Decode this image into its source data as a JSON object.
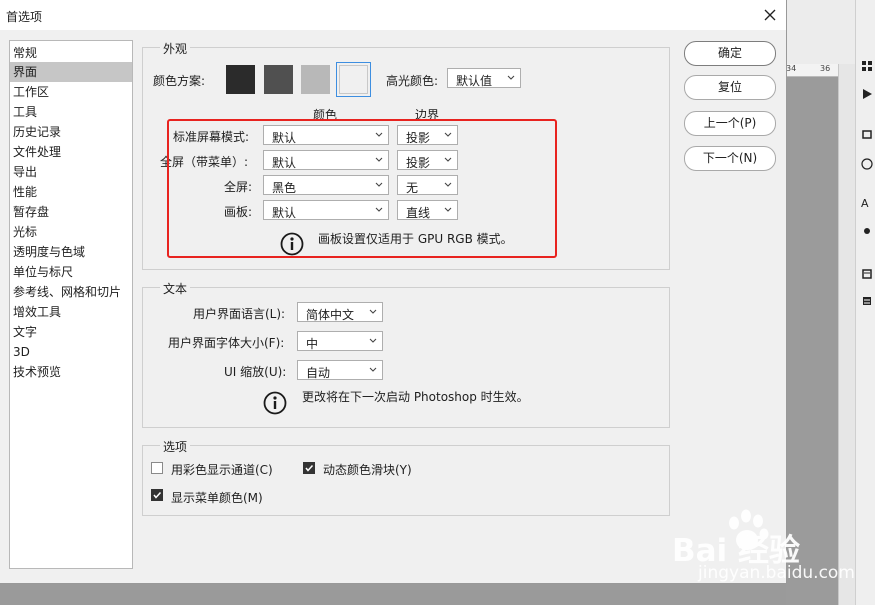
{
  "window": {
    "title": "首选项"
  },
  "sidebar": {
    "items": [
      {
        "label": "常规"
      },
      {
        "label": "界面"
      },
      {
        "label": "工作区"
      },
      {
        "label": "工具"
      },
      {
        "label": "历史记录"
      },
      {
        "label": "文件处理"
      },
      {
        "label": "导出"
      },
      {
        "label": "性能"
      },
      {
        "label": "暂存盘"
      },
      {
        "label": "光标"
      },
      {
        "label": "透明度与色域"
      },
      {
        "label": "单位与标尺"
      },
      {
        "label": "参考线、网格和切片"
      },
      {
        "label": "增效工具"
      },
      {
        "label": "文字"
      },
      {
        "label": "3D"
      },
      {
        "label": "技术预览"
      }
    ],
    "selected": "界面"
  },
  "appearance": {
    "group_label": "外观",
    "color_scheme_label": "颜色方案:",
    "swatch_colors": [
      "#2b2b2b",
      "#505050",
      "#b8b8b8",
      "#f0f0f0"
    ],
    "highlight_label": "高光颜色:",
    "highlight_value": "默认值",
    "col_color_header": "颜色",
    "col_border_header": "边界",
    "rows": [
      {
        "label": "标准屏幕模式:",
        "color": "默认",
        "border": "投影"
      },
      {
        "label": "全屏（带菜单）:",
        "color": "默认",
        "border": "投影"
      },
      {
        "label": "全屏:",
        "color": "黑色",
        "border": "无"
      },
      {
        "label": "画板:",
        "color": "默认",
        "border": "直线"
      }
    ],
    "note": "画板设置仅适用于 GPU RGB 模式。",
    "highlight_box_color": "#e8231f"
  },
  "text_group": {
    "group_label": "文本",
    "lang_label": "用户界面语言(L):",
    "lang_value": "简体中文",
    "font_size_label": "用户界面字体大小(F):",
    "font_size_value": "中",
    "ui_scale_label": "UI 缩放(U):",
    "ui_scale_value": "自动",
    "note": "更改将在下一次启动 Photoshop 时生效。"
  },
  "options_group": {
    "group_label": "选项",
    "channels_color": {
      "label": "用彩色显示通道(C)",
      "checked": false
    },
    "dynamic_sliders": {
      "label": "动态颜色滑块(Y)",
      "checked": true
    },
    "menu_colors": {
      "label": "显示菜单颜色(M)",
      "checked": true
    }
  },
  "buttons": {
    "ok": "确定",
    "reset": "复位",
    "prev": "上一个(P)",
    "next": "下一个(N)"
  },
  "background": {
    "ruler_ticks": [
      "34",
      "36"
    ]
  },
  "watermark": {
    "logo": "Bai 经验",
    "url": "jingyan.baidu.com"
  }
}
